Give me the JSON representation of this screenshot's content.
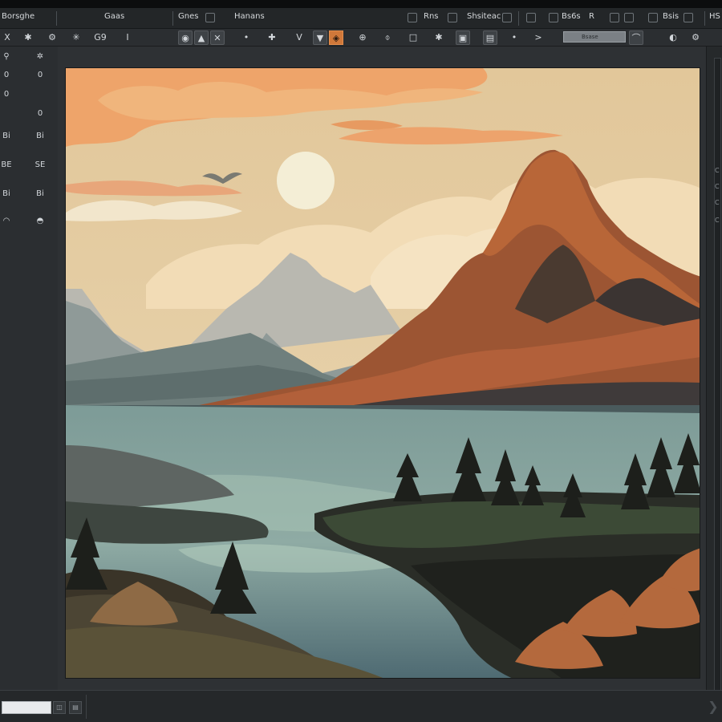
{
  "menubar": {
    "items": [
      "Borsghe",
      "Gaas",
      "Gnes",
      "Hanans",
      "Rns",
      "Shsiteac",
      "Bs6s",
      "Bsis",
      "HS"
    ],
    "extra": "R"
  },
  "toolbar": {
    "icon_labels": [
      "X",
      "✱",
      "⚙",
      "✳",
      "G9",
      "I",
      "◉",
      "▲",
      "✕",
      "•",
      "✚",
      "V",
      "▼",
      "◈",
      "⊕",
      "⌽",
      "□",
      "✱",
      "▣",
      "▤",
      "•",
      ">",
      "⌒",
      "◐",
      "⚙"
    ],
    "field_label": "Bsase"
  },
  "left_tools": {
    "rows": [
      {
        "a": "⚲",
        "b": "✲"
      },
      {
        "a": "0",
        "b": "0"
      },
      {
        "a": "0",
        "b": "0"
      },
      {
        "a": "Bi",
        "b": "Bi"
      },
      {
        "a": "BE",
        "b": "SE"
      },
      {
        "a": "Bi",
        "b": "Bi"
      },
      {
        "a": "◠",
        "b": "◓"
      }
    ]
  },
  "right_panel": {
    "glyphs": [
      "C",
      "C",
      "C",
      "C"
    ]
  },
  "status": {
    "buttons": [
      "◫",
      "▤"
    ],
    "arrow": "❯"
  },
  "colors": {
    "app_bg": "#2e3134",
    "accent": "#d0783a",
    "sky": "#e6cfa4",
    "sun": "#f3ecd2",
    "water": "#6f8f8e",
    "mountain": "#a85a35"
  },
  "canvas": {
    "artwork": "landscape-illustration"
  }
}
